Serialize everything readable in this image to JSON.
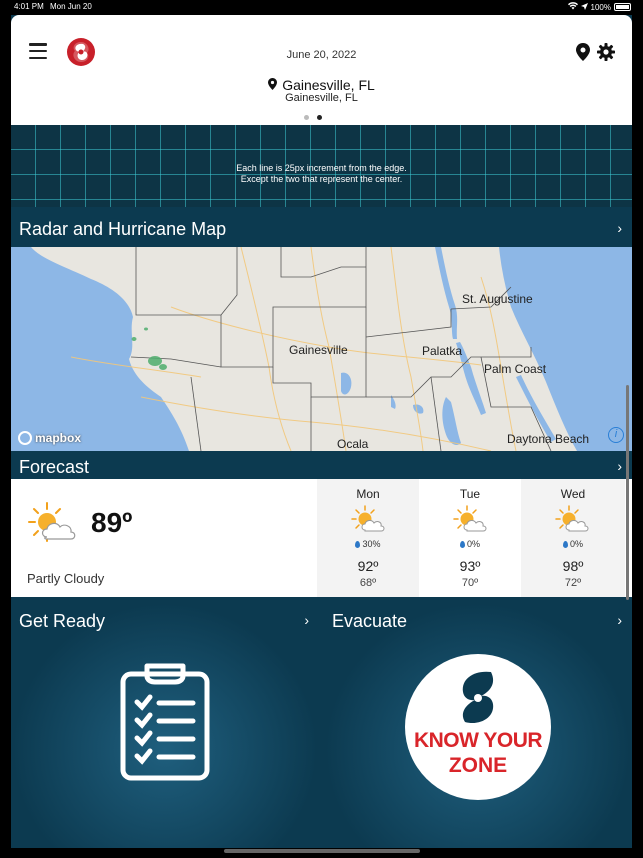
{
  "status_bar": {
    "time": "4:01 PM",
    "date": "Mon Jun 20",
    "battery": "100%"
  },
  "header": {
    "date": "June 20, 2022",
    "location": "Gainesville, FL",
    "location_sub": "Gainesville, FL",
    "icons": [
      "menu-icon",
      "hurricane-logo",
      "location-pin-icon",
      "gear-icon"
    ]
  },
  "grid_banner": {
    "line1": "Each line is 25px increment from the edge.",
    "line2": "Except the two that represent the center."
  },
  "radar": {
    "title": "Radar and Hurricane Map",
    "labels": [
      "St. Augustine",
      "Gainesville",
      "Palatka",
      "Palm Coast",
      "Ocala",
      "Daytona Beach"
    ],
    "attribution": "mapbox"
  },
  "forecast": {
    "title": "Forecast",
    "current": {
      "temp": "89º",
      "condition": "Partly Cloudy"
    },
    "days": [
      {
        "name": "Mon",
        "precip": "30%",
        "hi": "92º",
        "lo": "68º"
      },
      {
        "name": "Tue",
        "precip": "0%",
        "hi": "93º",
        "lo": "70º"
      },
      {
        "name": "Wed",
        "precip": "0%",
        "hi": "98º",
        "lo": "72º"
      }
    ]
  },
  "tiles": {
    "get_ready": "Get Ready",
    "evacuate": "Evacuate",
    "kyz_line1": "KNOW YOUR",
    "kyz_line2": "ZONE"
  },
  "colors": {
    "accent": "#0c3a50",
    "alert_red": "#d9252a",
    "water": "#8db7e6"
  }
}
